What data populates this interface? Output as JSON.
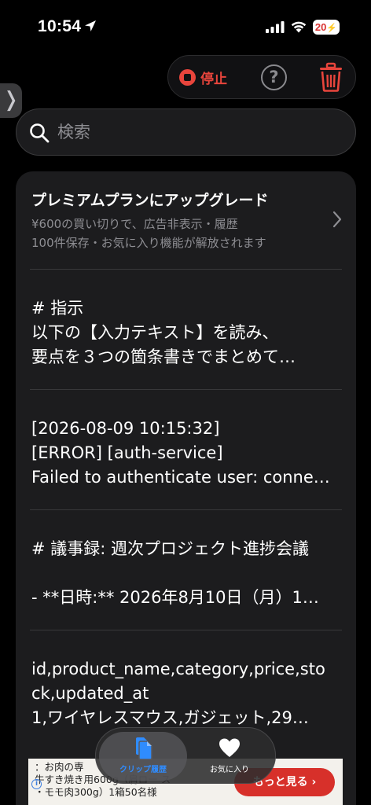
{
  "status_bar": {
    "time": "10:54",
    "battery": "20"
  },
  "toolbar": {
    "stop_label": "停止",
    "help_label": "?"
  },
  "side_tab": {
    "glyph": "❭"
  },
  "search": {
    "placeholder": "検索",
    "value": ""
  },
  "promo": {
    "title": "プレミアムプランにアップグレード",
    "line1": "¥600の買い切りで、広告非表示・履歴",
    "line2": "100件保存・お気に入り機能が解放されます"
  },
  "clips": [
    {
      "lines": [
        "# 指示",
        "以下の【入力テキスト】を読み、",
        "要点を３つの箇条書きでまとめて…"
      ]
    },
    {
      "lines": [
        "[2026-08-09 10:15:32]",
        "[ERROR] [auth-service]",
        "Failed to authenticate user: conne…"
      ]
    },
    {
      "lines": [
        "# 議事録: 週次プロジェクト進捗会議",
        "",
        "- **日時:** 2026年8月10日（月）1…"
      ]
    },
    {
      "lines": [
        "id,product_name,category,price,sto",
        "ck,updated_at",
        "1,ワイヤレスマウス,ガジェット,29…"
      ]
    }
  ],
  "ad": {
    "line1": "：お肉の専",
    "line2": "牛すき焼き用600g（肩ロー ス",
    "line3": "・モモ肉300g）1箱50名様",
    "button": "もっと見る ›"
  },
  "tabs": {
    "history": "クリップ履歴",
    "favorites": "お気に入り"
  },
  "colors": {
    "accent_red": "#e8453c",
    "accent_blue": "#2f8cff",
    "background": "#000000",
    "card": "#1c1c1e"
  }
}
